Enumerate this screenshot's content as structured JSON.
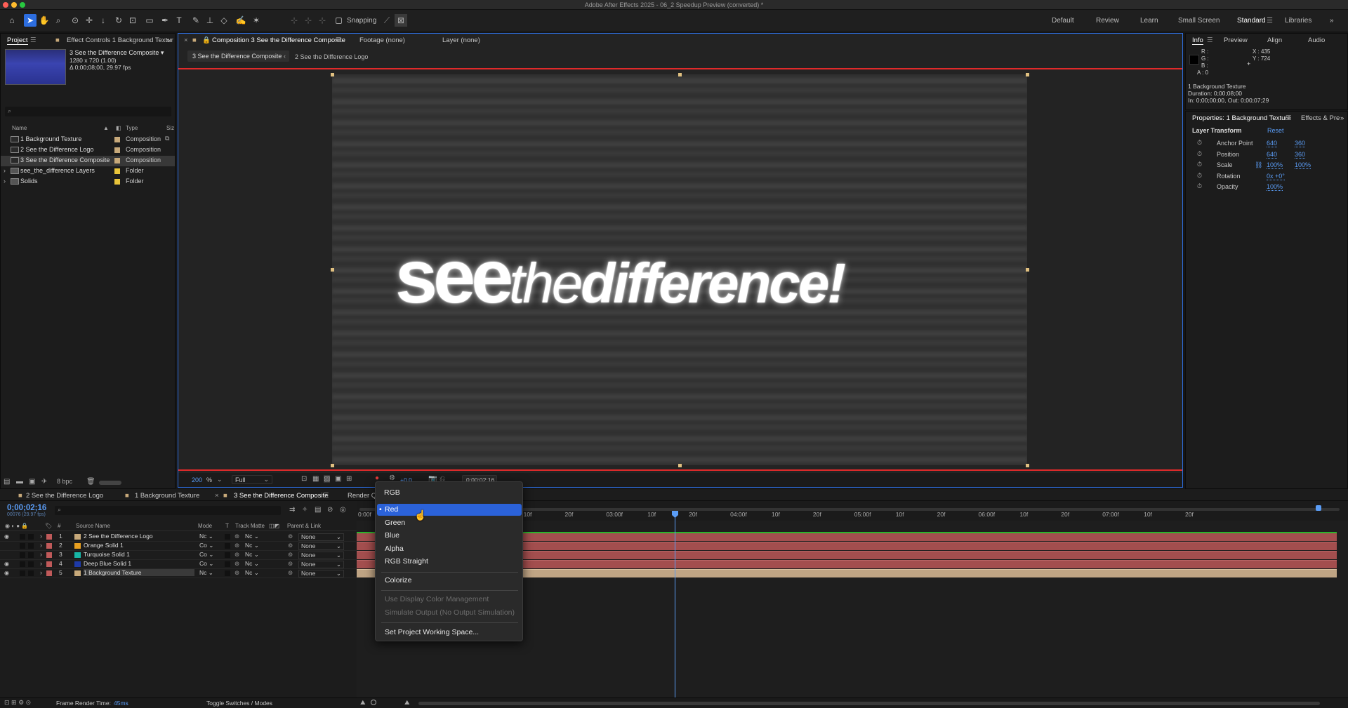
{
  "app": {
    "title": "Adobe After Effects 2025 - 06_2 Speedup Preview (converted) *"
  },
  "toolbar": {
    "snapping": "Snapping",
    "workspaces": [
      "Default",
      "Review",
      "Learn",
      "Small Screen",
      "Standard",
      "Libraries"
    ]
  },
  "project": {
    "tabs": {
      "project": "Project",
      "effect_controls": "Effect Controls 1 Background Textur"
    },
    "comp_name": "3 See the Difference Composite ▾",
    "comp_size": "1280 x 720 (1.00)",
    "comp_duration": "Δ 0;00;08;00, 29.97 fps",
    "columns": {
      "name": "Name",
      "type": "Type",
      "size": "Siz"
    },
    "items": [
      {
        "name": "1 Background Texture",
        "type": "Composition",
        "color": "#c7a97a"
      },
      {
        "name": "2 See the Difference Logo",
        "type": "Composition",
        "color": "#c7a97a"
      },
      {
        "name": "3 See the Difference Composite",
        "type": "Composition",
        "color": "#c7a97a"
      },
      {
        "name": "see_the_difference Layers",
        "type": "Folder",
        "color": "#e8c43a"
      },
      {
        "name": "Solids",
        "type": "Folder",
        "color": "#e8c43a"
      }
    ],
    "bpc": "8 bpc"
  },
  "viewer": {
    "tabs": {
      "composition": "Composition 3 See the Difference Composite",
      "footage": "Footage (none)",
      "layer": "Layer (none)"
    },
    "crumbs": [
      "3 See the Difference Composite",
      "2 See the Difference Logo"
    ],
    "logo": {
      "see": "see",
      "the": "the",
      "difference": "difference!"
    },
    "zoom": "200",
    "zoom_unit": "%",
    "resolution": "Full",
    "exposure": "+0.0",
    "timecode": "0;00;02;16"
  },
  "info": {
    "tabs": {
      "info": "Info",
      "preview": "Preview",
      "align": "Align",
      "audio": "Audio"
    },
    "rgb": {
      "r": "R :",
      "g": "G :",
      "b": "B :",
      "a": "A : 0"
    },
    "xy": {
      "x": "X : 435",
      "y": "Y : 724"
    },
    "layer": "1 Background Texture",
    "duration": "Duration: 0;00;08;00",
    "inout": "In: 0;00;00;00, Out: 0;00;07;29"
  },
  "properties": {
    "tab": "Properties: 1 Background Texture",
    "tab2": "Effects & Pre",
    "section": "Layer Transform",
    "reset": "Reset",
    "rows": [
      {
        "label": "Anchor Point",
        "v1": "640",
        "v2": "360"
      },
      {
        "label": "Position",
        "v1": "640",
        "v2": "360"
      },
      {
        "label": "Scale",
        "v1": "100%",
        "v2": "100%"
      },
      {
        "label": "Rotation",
        "v1": "0x +0°",
        "v2": ""
      },
      {
        "label": "Opacity",
        "v1": "100%",
        "v2": ""
      }
    ]
  },
  "timeline": {
    "tabs": [
      "2 See the Difference Logo",
      "1 Background Texture",
      "3 See the Difference Composite",
      "Render Q"
    ],
    "time": "0;00;02;16",
    "frames": "00076 (29.97 fps)",
    "columns": {
      "num": "#",
      "source": "Source Name",
      "mode": "Mode",
      "t": "T",
      "track": "Track Matte",
      "parent": "Parent & Link"
    },
    "layers": [
      {
        "num": "1",
        "name": "2 See the Difference Logo",
        "color": "#c7a97a",
        "mode": "Nc",
        "tm": "Nc",
        "parent": "None"
      },
      {
        "num": "2",
        "name": "Orange Solid 1",
        "color": "#e8a020",
        "mode": "Co",
        "tm": "Nc",
        "parent": "None"
      },
      {
        "num": "3",
        "name": "Turquoise Solid 1",
        "color": "#17b6a6",
        "mode": "Co",
        "tm": "Nc",
        "parent": "None"
      },
      {
        "num": "4",
        "name": "Deep Blue Solid 1",
        "color": "#1e3aa8",
        "mode": "Co",
        "tm": "Nc",
        "parent": "None"
      },
      {
        "num": "5",
        "name": "1 Background Texture",
        "color": "#c7a97a",
        "mode": "Nc",
        "tm": "Nc",
        "parent": "None"
      }
    ],
    "ruler": [
      "0:00f",
      "10f",
      "20f",
      "02:00f",
      "10f",
      "20f",
      "03:00f",
      "10f",
      "20f",
      "04:00f",
      "10f",
      "20f",
      "05:00f",
      "10f",
      "20f",
      "06:00f",
      "10f",
      "20f",
      "07:00f",
      "10f",
      "20f"
    ]
  },
  "dropdown": {
    "header": "RGB",
    "items": [
      "Red",
      "Green",
      "Blue",
      "Alpha",
      "RGB Straight"
    ],
    "selected": "Red",
    "colorize": "Colorize",
    "disabled": [
      "Use Display Color Management",
      "Simulate Output (No Output Simulation)"
    ],
    "working_space": "Set Project Working Space..."
  },
  "status": {
    "render_label": "Frame Render Time:",
    "render_time": "45ms",
    "toggle": "Toggle Switches / Modes"
  }
}
